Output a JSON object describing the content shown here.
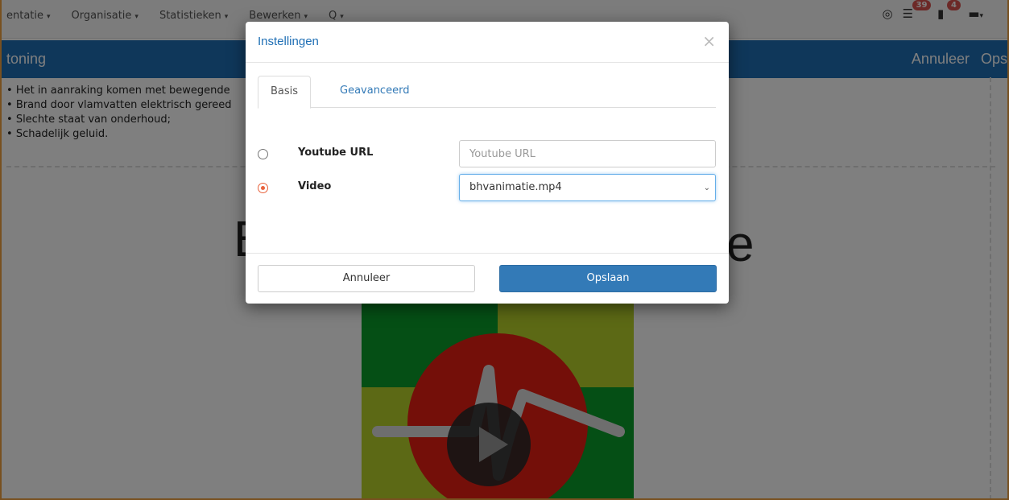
{
  "topnav": {
    "menu": [
      {
        "label": "entatie"
      },
      {
        "label": "Organisatie"
      },
      {
        "label": "Statistieken"
      },
      {
        "label": "Bewerken"
      },
      {
        "label": "Q"
      }
    ],
    "badges": {
      "list_count": "39",
      "doc_count": "4"
    }
  },
  "bluebar": {
    "title": "toning",
    "cancel_label": "Annuleer",
    "save_label": "Ops"
  },
  "content": {
    "bullets": [
      "Het in aanraking komen met bewegende",
      "Brand door vlamvatten elektrisch gereed",
      "Slechte staat van onderhoud;",
      "Schadelijk geluid."
    ],
    "big_left": "B",
    "big_right": "e"
  },
  "modal": {
    "title": "Instellingen",
    "close_glyph": "×",
    "tabs": [
      {
        "label": "Basis",
        "active": true
      },
      {
        "label": "Geavanceerd",
        "active": false
      }
    ],
    "youtube": {
      "label": "Youtube URL",
      "placeholder": "Youtube URL",
      "value": "",
      "selected": false
    },
    "video": {
      "label": "Video",
      "value": "bhvanimatie.mp4",
      "selected": true
    },
    "footer": {
      "cancel_label": "Annuleer",
      "save_label": "Opslaan"
    }
  },
  "colors": {
    "accent": "#337ab7",
    "header_bar": "#1f6fb5",
    "radio_checked": "#e8623c",
    "page_border": "#f0a040"
  }
}
